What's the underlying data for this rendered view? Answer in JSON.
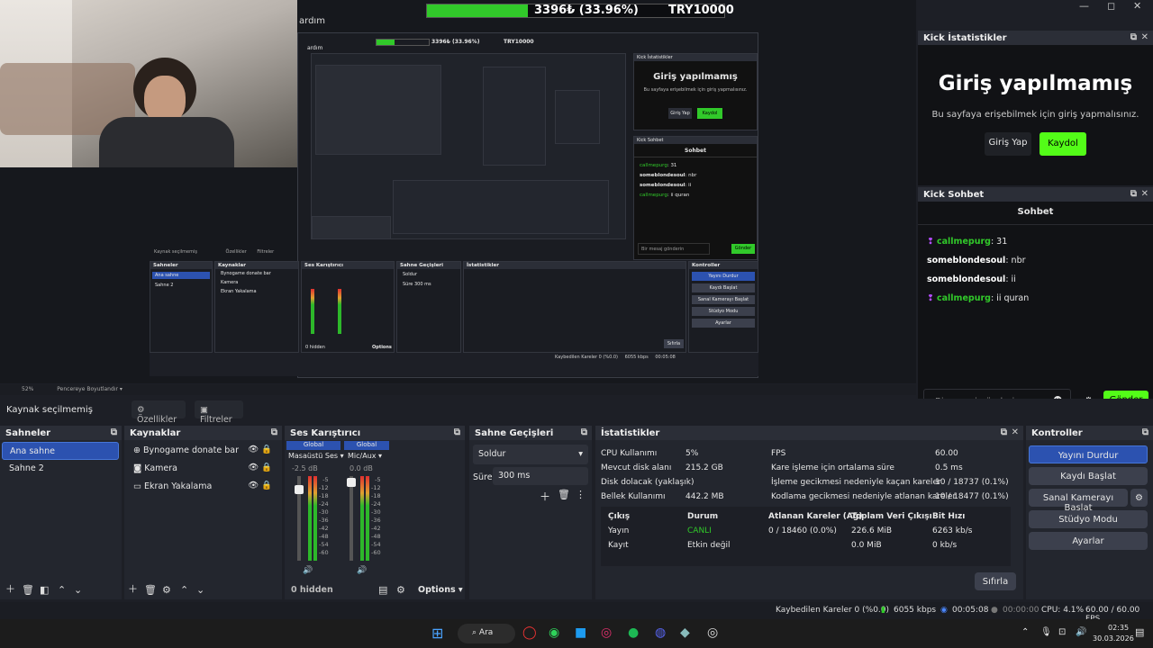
{
  "top_bar": {
    "menu_text": "ardım",
    "progress_text": "3396₺ (33.96%)",
    "goal_text": "TRY10000",
    "progress_fraction": 0.3396
  },
  "preview": {
    "nested_progress": "3396₺ (33.96%)",
    "nested_goal": "TRY10000",
    "zoom": "52%",
    "resize_label": "Pencereye Boyutlandır",
    "nested_stats_title": "Kick İstatistikler",
    "nested_chat_title": "Kick Sohbet",
    "nested_login_title": "Giriş yapılmamış",
    "nested_login_msg": "Bu sayfaya erişebilmek için giriş yapmalısınız.",
    "nested_login_btn": "Giriş Yap",
    "nested_register_btn": "Kaydol",
    "nested_chat_header": "Sohbet",
    "nested_chat_placeholder": "Bir mesaj gönderin",
    "nested_send": "Gönder",
    "nested_messages": [
      {
        "user": "callmepurg",
        "text": "31"
      },
      {
        "user": "someblondesoul",
        "text": "nbr"
      },
      {
        "user": "someblondesoul",
        "text": "ii"
      },
      {
        "user": "callmepurg",
        "text": "ii quran"
      }
    ],
    "nested_source_status": "Kaynak seçilmemiş",
    "nested_props": "Özellikler",
    "nested_filters": "Filtreler",
    "nested_panels": [
      "Sahneler",
      "Kaynaklar",
      "Ses Karıştırıcı",
      "Sahne Geçişleri",
      "İstatistikler",
      "Kontroller"
    ],
    "nested_scenes": [
      "Ana sahne",
      "Sahne 2"
    ],
    "nested_sources": [
      "Bynogame donate bar",
      "Kamera",
      "Ekran Yakalama"
    ],
    "nested_controls": [
      "Yayını Durdur",
      "Kaydı Başlat",
      "Sanal Kamerayı Başlat",
      "Stüdyo Modu",
      "Ayarlar"
    ],
    "nested_hidden": "0 hidden",
    "nested_options": "Options",
    "nested_reset": "Sıfırla",
    "nested_transition": "Soldur",
    "nested_duration_label": "Süre",
    "nested_duration": "300 ms",
    "nested_status": "Kaybedilen Kareler 0 (%0.0)",
    "nested_kbps": "6055 kbps",
    "nested_time": "00:05:08"
  },
  "kick_stats": {
    "title": "Kick İstatistikler",
    "heading": "Giriş yapılmamış",
    "message": "Bu sayfaya erişebilmek için giriş yapmalısınız.",
    "login_btn": "Giriş Yap",
    "register_btn": "Kaydol"
  },
  "kick_chat": {
    "title": "Kick Sohbet",
    "header": "Sohbet",
    "placeholder": "Bir mesaj gönderin",
    "send": "Gönder",
    "messages": [
      {
        "user": "callmepurg",
        "text": ": 31",
        "badge": true
      },
      {
        "user": "someblondesoul",
        "text": ": nbr",
        "badge": false
      },
      {
        "user": "someblondesoul",
        "text": ": ii",
        "badge": false
      },
      {
        "user": "callmepurg",
        "text": ": ii quran",
        "badge": true
      }
    ]
  },
  "zoom_bar": {
    "zoom": "52%",
    "resize": "Pencereye Boyutlandır"
  },
  "source_bar": {
    "status": "Kaynak seçilmemiş",
    "properties": "Özellikler",
    "filters": "Filtreler"
  },
  "scenes": {
    "title": "Sahneler",
    "items": [
      "Ana sahne",
      "Sahne 2"
    ],
    "selected": 0
  },
  "sources": {
    "title": "Kaynaklar",
    "items": [
      {
        "name": "Bynogame donate bar",
        "icon": "globe-icon"
      },
      {
        "name": "Kamera",
        "icon": "camera-icon"
      },
      {
        "name": "Ekran Yakalama",
        "icon": "monitor-icon"
      }
    ]
  },
  "mixer": {
    "title": "Ses Karıştırıcı",
    "channels": [
      {
        "header": "Global",
        "name": "Masaüstü Ses",
        "db": "-2.5 dB"
      },
      {
        "header": "Global",
        "name": "Mic/Aux",
        "db": "0.0 dB"
      }
    ],
    "scale": [
      "-5",
      "-12",
      "-18",
      "-24",
      "-30",
      "-36",
      "-42",
      "-48",
      "-54",
      "-60"
    ],
    "hidden": "0 hidden",
    "options": "Options"
  },
  "transitions": {
    "title": "Sahne Geçişleri",
    "selected": "Soldur",
    "duration_label": "Süre",
    "duration": "300 ms"
  },
  "stats": {
    "title": "İstatistikler",
    "left": [
      {
        "label": "CPU Kullanımı",
        "value": "5%"
      },
      {
        "label": "Mevcut disk alanı",
        "value": "215.2 GB"
      },
      {
        "label": "Disk dolacak (yaklaşık)",
        "value": ""
      },
      {
        "label": "Bellek Kullanımı",
        "value": "442.2 MB"
      }
    ],
    "right": [
      {
        "label": "FPS",
        "value": "60.00"
      },
      {
        "label": "Kare işleme için ortalama süre",
        "value": "0.5 ms"
      },
      {
        "label": "İşleme gecikmesi nedeniyle kaçan kareler",
        "value": "10 / 18737 (0.1%)"
      },
      {
        "label": "Kodlama gecikmesi nedeniyle atlanan kareler",
        "value": "10 / 18477 (0.1%)"
      }
    ],
    "table_headers": [
      "Çıkış",
      "Durum",
      "Atlanan Kareler (Ağ)",
      "Toplam Veri Çıkışı",
      "Bit Hızı"
    ],
    "table_rows": [
      [
        "Yayın",
        "CANLI",
        "0 / 18460 (0.0%)",
        "226.6 MiB",
        "6263 kb/s"
      ],
      [
        "Kayıt",
        "Etkin değil",
        "",
        "0.0 MiB",
        "0 kb/s"
      ]
    ],
    "reset": "Sıfırla"
  },
  "controls": {
    "title": "Kontroller",
    "buttons": [
      "Yayını Durdur",
      "Kaydı Başlat",
      "Sanal Kamerayı Başlat",
      "Stüdyo Modu",
      "Ayarlar"
    ]
  },
  "status_bar": {
    "dropped": "Kaybedilen Kareler 0 (%0.0)",
    "kbps": "6055 kbps",
    "stream_time": "00:05:08",
    "rec_time": "00:00:00",
    "cpu": "CPU: 4.1%",
    "fps": "60.00 / 60.00 FPS"
  },
  "taskbar": {
    "search": "Ara",
    "time": "02:35",
    "date": "30.03.2026",
    "colors": {
      "accent": "#31c92a",
      "selected": "#2c52b0"
    }
  }
}
